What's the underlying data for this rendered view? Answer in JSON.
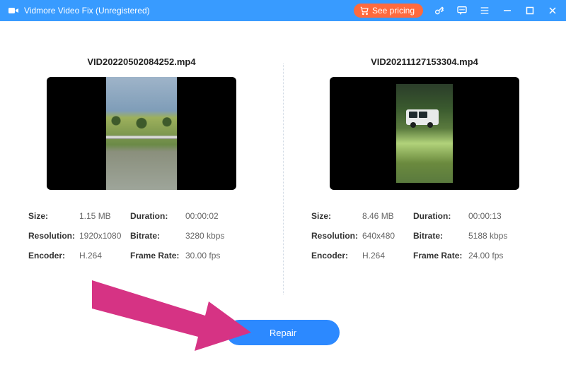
{
  "titlebar": {
    "app_name": "Vidmore Video Fix",
    "registration_suffix": " (Unregistered)",
    "see_pricing": "See pricing"
  },
  "videos": {
    "left": {
      "filename": "VID20220502084252.mp4",
      "size_label": "Size:",
      "size": "1.15 MB",
      "duration_label": "Duration:",
      "duration": "00:00:02",
      "resolution_label": "Resolution:",
      "resolution": "1920x1080",
      "bitrate_label": "Bitrate:",
      "bitrate": "3280 kbps",
      "encoder_label": "Encoder:",
      "encoder": "H.264",
      "framerate_label": "Frame Rate:",
      "framerate": "30.00 fps"
    },
    "right": {
      "filename": "VID20211127153304.mp4",
      "size_label": "Size:",
      "size": "8.46 MB",
      "duration_label": "Duration:",
      "duration": "00:00:13",
      "resolution_label": "Resolution:",
      "resolution": "640x480",
      "bitrate_label": "Bitrate:",
      "bitrate": "5188 kbps",
      "encoder_label": "Encoder:",
      "encoder": "H.264",
      "framerate_label": "Frame Rate:",
      "framerate": "24.00 fps"
    }
  },
  "actions": {
    "repair": "Repair"
  }
}
